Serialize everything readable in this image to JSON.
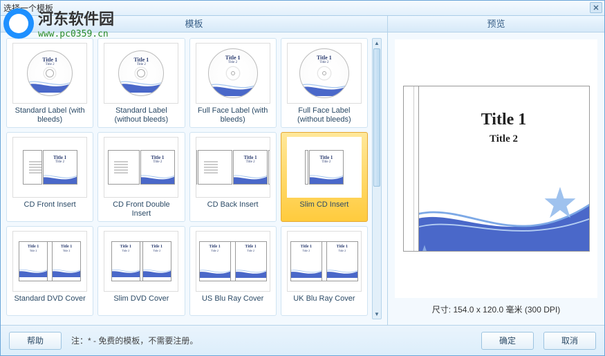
{
  "window": {
    "title": "选择一个模板"
  },
  "watermark": {
    "title": "河东软件园",
    "url": "www.pc0359.cn"
  },
  "headers": {
    "templates": "模板",
    "preview": "预览"
  },
  "templates": [
    {
      "label": "Standard Label (with bleeds)",
      "kind": "disc",
      "selected": false
    },
    {
      "label": "Standard Label (without bleeds)",
      "kind": "disc",
      "selected": false
    },
    {
      "label": "Full Face Label (with bleeds)",
      "kind": "discfull",
      "selected": false
    },
    {
      "label": "Full Face Label (without bleeds)",
      "kind": "discfull",
      "selected": false
    },
    {
      "label": "CD Front Insert",
      "kind": "cdfront",
      "selected": false
    },
    {
      "label": "CD Front Double Insert",
      "kind": "cddouble",
      "selected": false
    },
    {
      "label": "CD Back Insert",
      "kind": "cdback",
      "selected": false
    },
    {
      "label": "Slim CD Insert",
      "kind": "slimcd",
      "selected": true
    },
    {
      "label": "Standard DVD Cover",
      "kind": "dvd",
      "selected": false
    },
    {
      "label": "Slim DVD Cover",
      "kind": "dvdslim",
      "selected": false
    },
    {
      "label": "US Blu Ray Cover",
      "kind": "bluray",
      "selected": false
    },
    {
      "label": "UK Blu Ray Cover",
      "kind": "bluray",
      "selected": false
    }
  ],
  "preview": {
    "title1": "Title 1",
    "title2": "Title 2",
    "dimensions": "尺寸: 154.0 x 120.0 毫米 (300 DPI)"
  },
  "thumb": {
    "title1": "Title 1",
    "title2": "Title 2"
  },
  "footer": {
    "help": "帮助",
    "note": "注：* - 免费的模板，不需要注册。",
    "ok": "确定",
    "cancel": "取消"
  }
}
